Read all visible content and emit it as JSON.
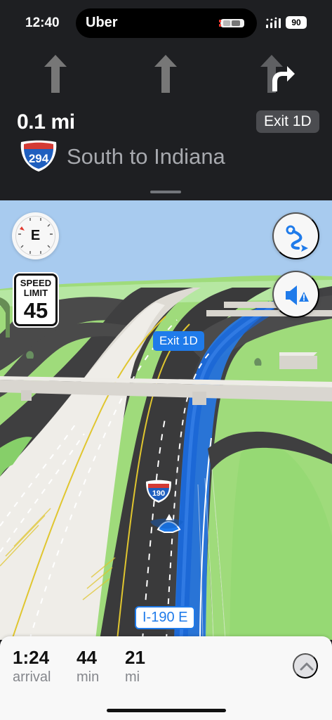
{
  "status_bar": {
    "time": "12:40",
    "live_activity_app": "Uber",
    "battery": "90",
    "icons": [
      "car-icon",
      "signal-icon",
      "battery-icon"
    ]
  },
  "navigation": {
    "distance": "0.1 mi",
    "exit_label": "Exit 1D",
    "route_number": "294",
    "instruction": "South to Indiana",
    "lane_icons": [
      "straight-arrow-icon",
      "straight-arrow-icon",
      "right-turn-arrow-icon"
    ],
    "shield_colors": {
      "blue": "#1f5fbf",
      "red": "#d43b35",
      "white": "#ffffff"
    }
  },
  "map": {
    "compass_heading": "E",
    "speed_limit_label_line_1": "SPEED",
    "speed_limit_label_line_2": "LIMIT",
    "speed_limit_value": "45",
    "exit_label": "Exit 1D",
    "highway_marker": "190",
    "road_name": "I-190 E",
    "route_color": "#1f7bea",
    "buttons": [
      "route-overview-button",
      "audio-alert-button"
    ]
  },
  "trip": {
    "arrival_time": "1:24",
    "arrival_label": "arrival",
    "duration_value": "44",
    "duration_label": "min",
    "distance_value": "21",
    "distance_label": "mi"
  }
}
